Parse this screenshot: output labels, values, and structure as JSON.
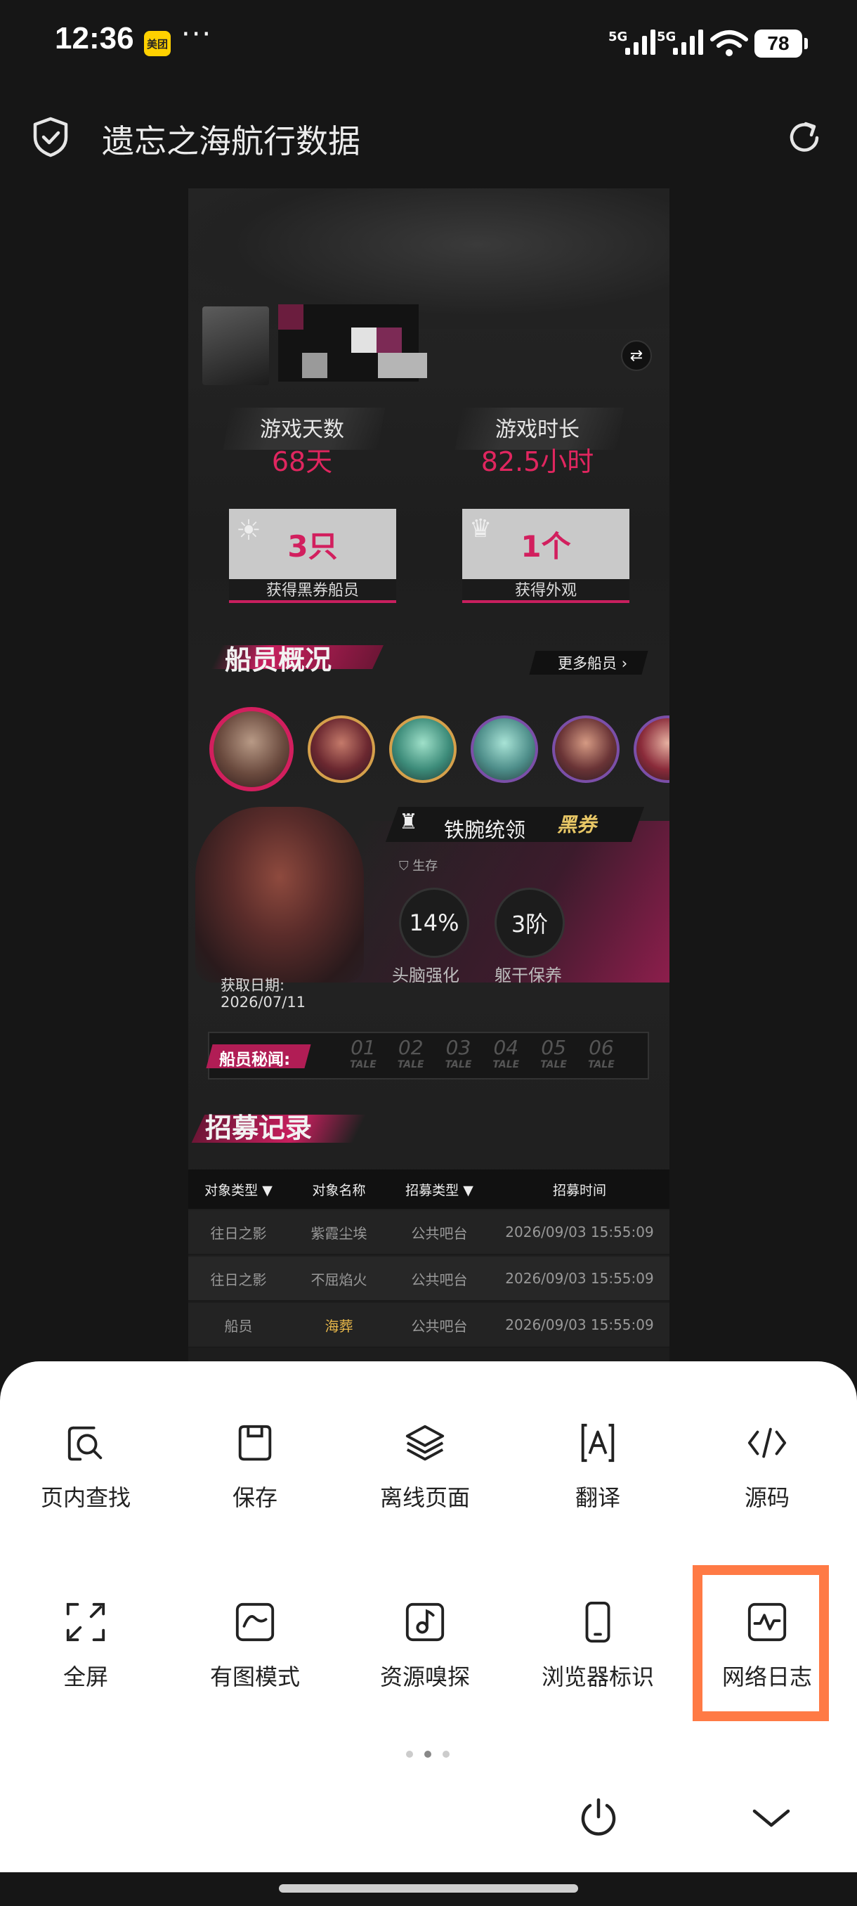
{
  "status_bar": {
    "time": "12:36",
    "app_badge": "美团",
    "more": "···",
    "signal1_label": "5G",
    "signal2_label": "5G",
    "battery": "78"
  },
  "browser": {
    "title": "遗忘之海航行数据"
  },
  "page": {
    "stats": [
      {
        "label": "游戏天数",
        "value": "68天"
      },
      {
        "label": "游戏时长",
        "value": "82.5小时"
      }
    ],
    "cards": [
      {
        "value": "3只",
        "label": "获得黑券船员"
      },
      {
        "value": "1个",
        "label": "获得外观"
      }
    ],
    "crew_section_title": "船员概况",
    "more_crew": "更多船员",
    "featured": {
      "name": "铁腕统领",
      "badge": "黑券",
      "camp": "生存",
      "skill1_value": "14%",
      "skill1_label": "头脑强化",
      "skill2_value": "3阶",
      "skill2_label": "躯干保养",
      "date_label": "获取日期:",
      "date": "2026/07/11"
    },
    "secrets_label": "船员秘闻:",
    "tales": [
      {
        "num": "01",
        "tag": "TALE"
      },
      {
        "num": "02",
        "tag": "TALE"
      },
      {
        "num": "03",
        "tag": "TALE"
      },
      {
        "num": "04",
        "tag": "TALE"
      },
      {
        "num": "05",
        "tag": "TALE"
      },
      {
        "num": "06",
        "tag": "TALE"
      }
    ],
    "recruit_title": "招募记录",
    "table": {
      "headers": [
        "对象类型",
        "对象名称",
        "招募类型",
        "招募时间"
      ],
      "rows": [
        [
          "往日之影",
          "紫霞尘埃",
          "公共吧台",
          "2026/09/03 15:55:09"
        ],
        [
          "往日之影",
          "不屈焰火",
          "公共吧台",
          "2026/09/03 15:55:09"
        ],
        [
          "船员",
          "海葬",
          "公共吧台",
          "2026/09/03 15:55:09"
        ]
      ]
    }
  },
  "menu": {
    "items": [
      {
        "label": "页内查找",
        "icon": "search-in-page-icon"
      },
      {
        "label": "保存",
        "icon": "save-icon"
      },
      {
        "label": "离线页面",
        "icon": "layers-icon"
      },
      {
        "label": "翻译",
        "icon": "translate-icon"
      },
      {
        "label": "源码",
        "icon": "code-icon"
      },
      {
        "label": "全屏",
        "icon": "fullscreen-icon"
      },
      {
        "label": "有图模式",
        "icon": "image-mode-icon"
      },
      {
        "label": "资源嗅探",
        "icon": "music-icon"
      },
      {
        "label": "浏览器标识",
        "icon": "phone-icon"
      },
      {
        "label": "网络日志",
        "icon": "activity-icon"
      }
    ],
    "highlight_color": "#ff7a45"
  }
}
